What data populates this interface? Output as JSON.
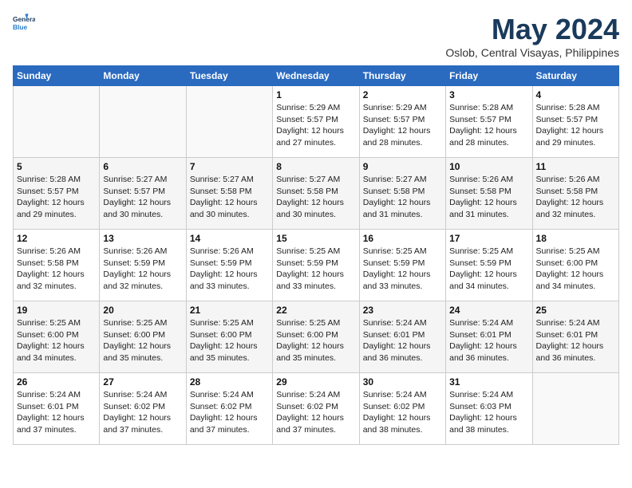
{
  "logo": {
    "line1": "General",
    "line2": "Blue"
  },
  "title": "May 2024",
  "subtitle": "Oslob, Central Visayas, Philippines",
  "headers": [
    "Sunday",
    "Monday",
    "Tuesday",
    "Wednesday",
    "Thursday",
    "Friday",
    "Saturday"
  ],
  "rows": [
    [
      {
        "day": "",
        "info": ""
      },
      {
        "day": "",
        "info": ""
      },
      {
        "day": "",
        "info": ""
      },
      {
        "day": "1",
        "info": "Sunrise: 5:29 AM\nSunset: 5:57 PM\nDaylight: 12 hours\nand 27 minutes."
      },
      {
        "day": "2",
        "info": "Sunrise: 5:29 AM\nSunset: 5:57 PM\nDaylight: 12 hours\nand 28 minutes."
      },
      {
        "day": "3",
        "info": "Sunrise: 5:28 AM\nSunset: 5:57 PM\nDaylight: 12 hours\nand 28 minutes."
      },
      {
        "day": "4",
        "info": "Sunrise: 5:28 AM\nSunset: 5:57 PM\nDaylight: 12 hours\nand 29 minutes."
      }
    ],
    [
      {
        "day": "5",
        "info": "Sunrise: 5:28 AM\nSunset: 5:57 PM\nDaylight: 12 hours\nand 29 minutes."
      },
      {
        "day": "6",
        "info": "Sunrise: 5:27 AM\nSunset: 5:57 PM\nDaylight: 12 hours\nand 30 minutes."
      },
      {
        "day": "7",
        "info": "Sunrise: 5:27 AM\nSunset: 5:58 PM\nDaylight: 12 hours\nand 30 minutes."
      },
      {
        "day": "8",
        "info": "Sunrise: 5:27 AM\nSunset: 5:58 PM\nDaylight: 12 hours\nand 30 minutes."
      },
      {
        "day": "9",
        "info": "Sunrise: 5:27 AM\nSunset: 5:58 PM\nDaylight: 12 hours\nand 31 minutes."
      },
      {
        "day": "10",
        "info": "Sunrise: 5:26 AM\nSunset: 5:58 PM\nDaylight: 12 hours\nand 31 minutes."
      },
      {
        "day": "11",
        "info": "Sunrise: 5:26 AM\nSunset: 5:58 PM\nDaylight: 12 hours\nand 32 minutes."
      }
    ],
    [
      {
        "day": "12",
        "info": "Sunrise: 5:26 AM\nSunset: 5:58 PM\nDaylight: 12 hours\nand 32 minutes."
      },
      {
        "day": "13",
        "info": "Sunrise: 5:26 AM\nSunset: 5:59 PM\nDaylight: 12 hours\nand 32 minutes."
      },
      {
        "day": "14",
        "info": "Sunrise: 5:26 AM\nSunset: 5:59 PM\nDaylight: 12 hours\nand 33 minutes."
      },
      {
        "day": "15",
        "info": "Sunrise: 5:25 AM\nSunset: 5:59 PM\nDaylight: 12 hours\nand 33 minutes."
      },
      {
        "day": "16",
        "info": "Sunrise: 5:25 AM\nSunset: 5:59 PM\nDaylight: 12 hours\nand 33 minutes."
      },
      {
        "day": "17",
        "info": "Sunrise: 5:25 AM\nSunset: 5:59 PM\nDaylight: 12 hours\nand 34 minutes."
      },
      {
        "day": "18",
        "info": "Sunrise: 5:25 AM\nSunset: 6:00 PM\nDaylight: 12 hours\nand 34 minutes."
      }
    ],
    [
      {
        "day": "19",
        "info": "Sunrise: 5:25 AM\nSunset: 6:00 PM\nDaylight: 12 hours\nand 34 minutes."
      },
      {
        "day": "20",
        "info": "Sunrise: 5:25 AM\nSunset: 6:00 PM\nDaylight: 12 hours\nand 35 minutes."
      },
      {
        "day": "21",
        "info": "Sunrise: 5:25 AM\nSunset: 6:00 PM\nDaylight: 12 hours\nand 35 minutes."
      },
      {
        "day": "22",
        "info": "Sunrise: 5:25 AM\nSunset: 6:00 PM\nDaylight: 12 hours\nand 35 minutes."
      },
      {
        "day": "23",
        "info": "Sunrise: 5:24 AM\nSunset: 6:01 PM\nDaylight: 12 hours\nand 36 minutes."
      },
      {
        "day": "24",
        "info": "Sunrise: 5:24 AM\nSunset: 6:01 PM\nDaylight: 12 hours\nand 36 minutes."
      },
      {
        "day": "25",
        "info": "Sunrise: 5:24 AM\nSunset: 6:01 PM\nDaylight: 12 hours\nand 36 minutes."
      }
    ],
    [
      {
        "day": "26",
        "info": "Sunrise: 5:24 AM\nSunset: 6:01 PM\nDaylight: 12 hours\nand 37 minutes."
      },
      {
        "day": "27",
        "info": "Sunrise: 5:24 AM\nSunset: 6:02 PM\nDaylight: 12 hours\nand 37 minutes."
      },
      {
        "day": "28",
        "info": "Sunrise: 5:24 AM\nSunset: 6:02 PM\nDaylight: 12 hours\nand 37 minutes."
      },
      {
        "day": "29",
        "info": "Sunrise: 5:24 AM\nSunset: 6:02 PM\nDaylight: 12 hours\nand 37 minutes."
      },
      {
        "day": "30",
        "info": "Sunrise: 5:24 AM\nSunset: 6:02 PM\nDaylight: 12 hours\nand 38 minutes."
      },
      {
        "day": "31",
        "info": "Sunrise: 5:24 AM\nSunset: 6:03 PM\nDaylight: 12 hours\nand 38 minutes."
      },
      {
        "day": "",
        "info": ""
      }
    ]
  ]
}
